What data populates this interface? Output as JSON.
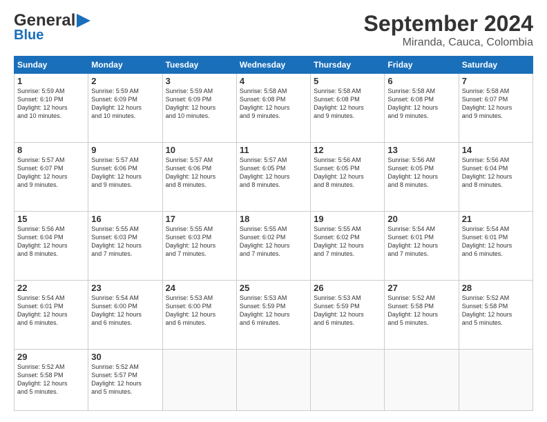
{
  "header": {
    "logo_text_general": "General",
    "logo_text_blue": "Blue",
    "title": "September 2024",
    "subtitle": "Miranda, Cauca, Colombia"
  },
  "calendar": {
    "days": [
      "Sunday",
      "Monday",
      "Tuesday",
      "Wednesday",
      "Thursday",
      "Friday",
      "Saturday"
    ],
    "weeks": [
      [
        {
          "day": "",
          "info": ""
        },
        {
          "day": "2",
          "info": "Sunrise: 5:59 AM\nSunset: 6:09 PM\nDaylight: 12 hours\nand 10 minutes."
        },
        {
          "day": "3",
          "info": "Sunrise: 5:59 AM\nSunset: 6:09 PM\nDaylight: 12 hours\nand 10 minutes."
        },
        {
          "day": "4",
          "info": "Sunrise: 5:58 AM\nSunset: 6:08 PM\nDaylight: 12 hours\nand 9 minutes."
        },
        {
          "day": "5",
          "info": "Sunrise: 5:58 AM\nSunset: 6:08 PM\nDaylight: 12 hours\nand 9 minutes."
        },
        {
          "day": "6",
          "info": "Sunrise: 5:58 AM\nSunset: 6:08 PM\nDaylight: 12 hours\nand 9 minutes."
        },
        {
          "day": "7",
          "info": "Sunrise: 5:58 AM\nSunset: 6:07 PM\nDaylight: 12 hours\nand 9 minutes."
        }
      ],
      [
        {
          "day": "8",
          "info": "Sunrise: 5:57 AM\nSunset: 6:07 PM\nDaylight: 12 hours\nand 9 minutes."
        },
        {
          "day": "9",
          "info": "Sunrise: 5:57 AM\nSunset: 6:06 PM\nDaylight: 12 hours\nand 9 minutes."
        },
        {
          "day": "10",
          "info": "Sunrise: 5:57 AM\nSunset: 6:06 PM\nDaylight: 12 hours\nand 8 minutes."
        },
        {
          "day": "11",
          "info": "Sunrise: 5:57 AM\nSunset: 6:05 PM\nDaylight: 12 hours\nand 8 minutes."
        },
        {
          "day": "12",
          "info": "Sunrise: 5:56 AM\nSunset: 6:05 PM\nDaylight: 12 hours\nand 8 minutes."
        },
        {
          "day": "13",
          "info": "Sunrise: 5:56 AM\nSunset: 6:05 PM\nDaylight: 12 hours\nand 8 minutes."
        },
        {
          "day": "14",
          "info": "Sunrise: 5:56 AM\nSunset: 6:04 PM\nDaylight: 12 hours\nand 8 minutes."
        }
      ],
      [
        {
          "day": "15",
          "info": "Sunrise: 5:56 AM\nSunset: 6:04 PM\nDaylight: 12 hours\nand 8 minutes."
        },
        {
          "day": "16",
          "info": "Sunrise: 5:55 AM\nSunset: 6:03 PM\nDaylight: 12 hours\nand 7 minutes."
        },
        {
          "day": "17",
          "info": "Sunrise: 5:55 AM\nSunset: 6:03 PM\nDaylight: 12 hours\nand 7 minutes."
        },
        {
          "day": "18",
          "info": "Sunrise: 5:55 AM\nSunset: 6:02 PM\nDaylight: 12 hours\nand 7 minutes."
        },
        {
          "day": "19",
          "info": "Sunrise: 5:55 AM\nSunset: 6:02 PM\nDaylight: 12 hours\nand 7 minutes."
        },
        {
          "day": "20",
          "info": "Sunrise: 5:54 AM\nSunset: 6:01 PM\nDaylight: 12 hours\nand 7 minutes."
        },
        {
          "day": "21",
          "info": "Sunrise: 5:54 AM\nSunset: 6:01 PM\nDaylight: 12 hours\nand 6 minutes."
        }
      ],
      [
        {
          "day": "22",
          "info": "Sunrise: 5:54 AM\nSunset: 6:01 PM\nDaylight: 12 hours\nand 6 minutes."
        },
        {
          "day": "23",
          "info": "Sunrise: 5:54 AM\nSunset: 6:00 PM\nDaylight: 12 hours\nand 6 minutes."
        },
        {
          "day": "24",
          "info": "Sunrise: 5:53 AM\nSunset: 6:00 PM\nDaylight: 12 hours\nand 6 minutes."
        },
        {
          "day": "25",
          "info": "Sunrise: 5:53 AM\nSunset: 5:59 PM\nDaylight: 12 hours\nand 6 minutes."
        },
        {
          "day": "26",
          "info": "Sunrise: 5:53 AM\nSunset: 5:59 PM\nDaylight: 12 hours\nand 6 minutes."
        },
        {
          "day": "27",
          "info": "Sunrise: 5:52 AM\nSunset: 5:58 PM\nDaylight: 12 hours\nand 5 minutes."
        },
        {
          "day": "28",
          "info": "Sunrise: 5:52 AM\nSunset: 5:58 PM\nDaylight: 12 hours\nand 5 minutes."
        }
      ],
      [
        {
          "day": "29",
          "info": "Sunrise: 5:52 AM\nSunset: 5:58 PM\nDaylight: 12 hours\nand 5 minutes."
        },
        {
          "day": "30",
          "info": "Sunrise: 5:52 AM\nSunset: 5:57 PM\nDaylight: 12 hours\nand 5 minutes."
        },
        {
          "day": "",
          "info": ""
        },
        {
          "day": "",
          "info": ""
        },
        {
          "day": "",
          "info": ""
        },
        {
          "day": "",
          "info": ""
        },
        {
          "day": "",
          "info": ""
        }
      ]
    ],
    "week1_day1": {
      "day": "1",
      "info": "Sunrise: 5:59 AM\nSunset: 6:10 PM\nDaylight: 12 hours\nand 10 minutes."
    }
  }
}
